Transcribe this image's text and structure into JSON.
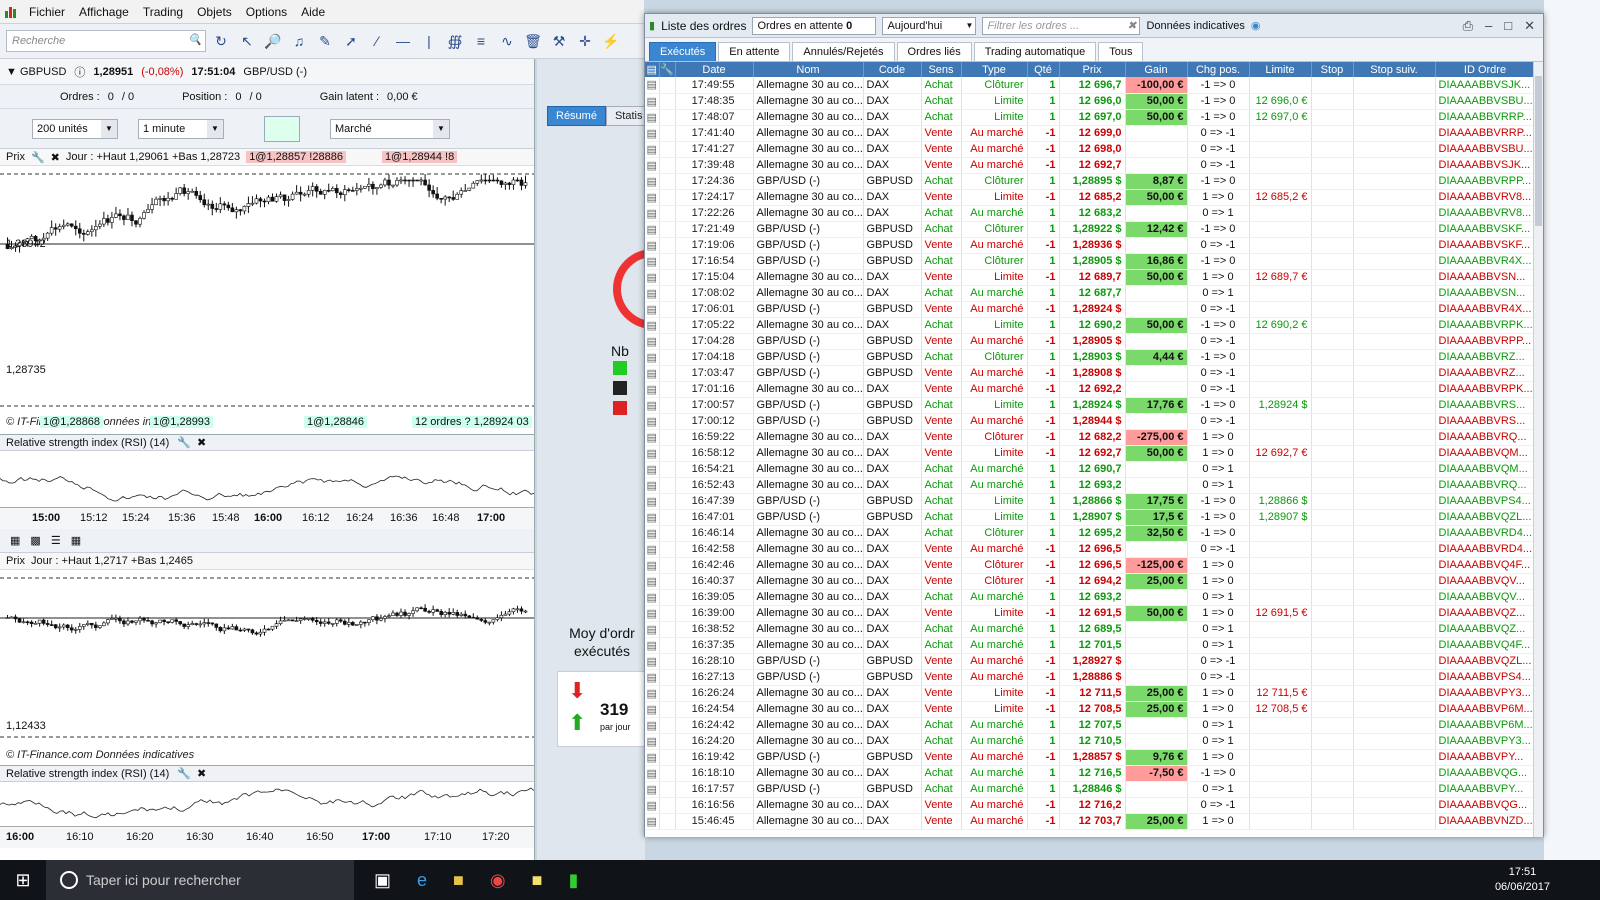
{
  "menu": {
    "items": [
      "Fichier",
      "Affichage",
      "Trading",
      "Objets",
      "Options",
      "Aide"
    ]
  },
  "toolbar": {
    "search_placeholder": "Recherche"
  },
  "symbol_bar": {
    "name": "GBPUSD",
    "price": "1,28951",
    "change": "(-0,08%)",
    "time": "17:51:04",
    "pair": "GBP/USD (-)"
  },
  "orders_bar": {
    "orders_label": "Ordres :",
    "orders_value": "0",
    "orders_slash": "/ 0",
    "position_label": "Position :",
    "position_value": "0",
    "position_slash": "/ 0",
    "gain_label": "Gain latent :",
    "gain_value": "0,00 €"
  },
  "controls": {
    "units": "200 unités",
    "timeframe": "1 minute",
    "order_type": "Marché"
  },
  "chart1": {
    "header": {
      "prefix": "Prix",
      "day": "Jour : +Haut 1,29061 +Bas 1,28723",
      "tag1": "1@1,28857 !28886",
      "tag2": "1@1,28944 !8"
    },
    "price_high": "1,28942",
    "price_low": "1,28735",
    "bottom_tags": [
      "1@1,28868",
      "1@1,28993",
      "1@1,28846",
      "12 ordres ? 1,28924 03"
    ],
    "footer": "© IT-Finance.com Données indicatives"
  },
  "rsi_label": "Relative strength index (RSI) (14)",
  "time_axis1": [
    "15:00",
    "15:12",
    "15:24",
    "15:36",
    "15:48",
    "16:00",
    "16:12",
    "16:24",
    "16:36",
    "16:48",
    "17:00"
  ],
  "chart2": {
    "header": {
      "prefix": "Prix",
      "day": "Jour : +Haut 1,2717 +Bas 1,2465"
    },
    "price_low": "1,12433",
    "footer": "© IT-Finance.com Données indicatives"
  },
  "time_axis2": [
    "16:00",
    "16:10",
    "16:20",
    "16:30",
    "16:40",
    "16:50",
    "17:00",
    "17:10",
    "17:20"
  ],
  "midpanel": {
    "tab1": "Résumé",
    "tab2": "Statis",
    "nb_label": "Nb",
    "avg_label": "Moy d'ordr exécutés",
    "count": "319",
    "per": "par jour"
  },
  "orders_window": {
    "title": "Liste des ordres",
    "pending_label": "Ordres en attente",
    "pending_count": "0",
    "date_select": "Aujourd'hui",
    "filter_placeholder": "Filtrer les ordres ...",
    "data_label": "Données indicatives",
    "tabs": [
      "Exécutés",
      "En attente",
      "Annulés/Rejetés",
      "Ordres liés",
      "Trading automatique",
      "Tous"
    ],
    "columns": [
      "Date",
      "Nom",
      "Code",
      "Sens",
      "Type",
      "Qté",
      "Prix",
      "Gain",
      "Chg pos.",
      "Limite",
      "Stop",
      "Stop suiv.",
      "ID Ordre"
    ],
    "rows": [
      {
        "date": "17:49:55",
        "nom": "Allemagne 30 au co...",
        "code": "DAX",
        "sens": "Achat",
        "type": "Clôturer",
        "qte": "1",
        "prix": "12 696,7",
        "gain": "-100,00 €",
        "chg": "-1 => 0",
        "limite": "",
        "id": "DIAAAABBVSJK..."
      },
      {
        "date": "17:48:35",
        "nom": "Allemagne 30 au co...",
        "code": "DAX",
        "sens": "Achat",
        "type": "Limite",
        "qte": "1",
        "prix": "12 696,0",
        "gain": "50,00 €",
        "chg": "-1 => 0",
        "limite": "12 696,0 €",
        "id": "DIAAAABBVSBU..."
      },
      {
        "date": "17:48:07",
        "nom": "Allemagne 30 au co...",
        "code": "DAX",
        "sens": "Achat",
        "type": "Limite",
        "qte": "1",
        "prix": "12 697,0",
        "gain": "50,00 €",
        "chg": "-1 => 0",
        "limite": "12 697,0 €",
        "id": "DIAAAABBVRRP..."
      },
      {
        "date": "17:41:40",
        "nom": "Allemagne 30 au co...",
        "code": "DAX",
        "sens": "Vente",
        "type": "Au marché",
        "qte": "-1",
        "prix": "12 699,0",
        "gain": "",
        "chg": "0 => -1",
        "limite": "",
        "id": "DIAAAABBVRRP..."
      },
      {
        "date": "17:41:27",
        "nom": "Allemagne 30 au co...",
        "code": "DAX",
        "sens": "Vente",
        "type": "Au marché",
        "qte": "-1",
        "prix": "12 698,0",
        "gain": "",
        "chg": "0 => -1",
        "limite": "",
        "id": "DIAAAABBVSBU..."
      },
      {
        "date": "17:39:48",
        "nom": "Allemagne 30 au co...",
        "code": "DAX",
        "sens": "Vente",
        "type": "Au marché",
        "qte": "-1",
        "prix": "12 692,7",
        "gain": "",
        "chg": "0 => -1",
        "limite": "",
        "id": "DIAAAABBVSJK..."
      },
      {
        "date": "17:24:36",
        "nom": "GBP/USD (-)",
        "code": "GBPUSD",
        "sens": "Achat",
        "type": "Clôturer",
        "qte": "1",
        "prix": "1,28895 $",
        "gain": "8,87 €",
        "chg": "-1 => 0",
        "limite": "",
        "id": "DIAAAABBVRPP..."
      },
      {
        "date": "17:24:17",
        "nom": "Allemagne 30 au co...",
        "code": "DAX",
        "sens": "Vente",
        "type": "Limite",
        "qte": "-1",
        "prix": "12 685,2",
        "gain": "50,00 €",
        "chg": "1 => 0",
        "limite": "12 685,2 €",
        "id": "DIAAAABBVRV8..."
      },
      {
        "date": "17:22:26",
        "nom": "Allemagne 30 au co...",
        "code": "DAX",
        "sens": "Achat",
        "type": "Au marché",
        "qte": "1",
        "prix": "12 683,2",
        "gain": "",
        "chg": "0 => 1",
        "limite": "",
        "id": "DIAAAABBVRV8..."
      },
      {
        "date": "17:21:49",
        "nom": "GBP/USD (-)",
        "code": "GBPUSD",
        "sens": "Achat",
        "type": "Clôturer",
        "qte": "1",
        "prix": "1,28922 $",
        "gain": "12,42 €",
        "chg": "-1 => 0",
        "limite": "",
        "id": "DIAAAABBVSKF..."
      },
      {
        "date": "17:19:06",
        "nom": "GBP/USD (-)",
        "code": "GBPUSD",
        "sens": "Vente",
        "type": "Au marché",
        "qte": "-1",
        "prix": "1,28936 $",
        "gain": "",
        "chg": "0 => -1",
        "limite": "",
        "id": "DIAAAABBVSKF..."
      },
      {
        "date": "17:16:54",
        "nom": "GBP/USD (-)",
        "code": "GBPUSD",
        "sens": "Achat",
        "type": "Clôturer",
        "qte": "1",
        "prix": "1,28905 $",
        "gain": "16,86 €",
        "chg": "-1 => 0",
        "limite": "",
        "id": "DIAAAABBVR4X..."
      },
      {
        "date": "17:15:04",
        "nom": "Allemagne 30 au co...",
        "code": "DAX",
        "sens": "Vente",
        "type": "Limite",
        "qte": "-1",
        "prix": "12 689,7",
        "gain": "50,00 €",
        "chg": "1 => 0",
        "limite": "12 689,7 €",
        "id": "DIAAAABBVSN..."
      },
      {
        "date": "17:08:02",
        "nom": "Allemagne 30 au co...",
        "code": "DAX",
        "sens": "Achat",
        "type": "Au marché",
        "qte": "1",
        "prix": "12 687,7",
        "gain": "",
        "chg": "0 => 1",
        "limite": "",
        "id": "DIAAAABBVSN..."
      },
      {
        "date": "17:06:01",
        "nom": "GBP/USD (-)",
        "code": "GBPUSD",
        "sens": "Vente",
        "type": "Au marché",
        "qte": "-1",
        "prix": "1,28924 $",
        "gain": "",
        "chg": "0 => -1",
        "limite": "",
        "id": "DIAAAABBVR4X..."
      },
      {
        "date": "17:05:22",
        "nom": "Allemagne 30 au co...",
        "code": "DAX",
        "sens": "Achat",
        "type": "Limite",
        "qte": "1",
        "prix": "12 690,2",
        "gain": "50,00 €",
        "chg": "-1 => 0",
        "limite": "12 690,2 €",
        "id": "DIAAAABBVRPK..."
      },
      {
        "date": "17:04:28",
        "nom": "GBP/USD (-)",
        "code": "GBPUSD",
        "sens": "Vente",
        "type": "Au marché",
        "qte": "-1",
        "prix": "1,28905 $",
        "gain": "",
        "chg": "0 => -1",
        "limite": "",
        "id": "DIAAAABBVRPP..."
      },
      {
        "date": "17:04:18",
        "nom": "GBP/USD (-)",
        "code": "GBPUSD",
        "sens": "Achat",
        "type": "Clôturer",
        "qte": "1",
        "prix": "1,28903 $",
        "gain": "4,44 €",
        "chg": "-1 => 0",
        "limite": "",
        "id": "DIAAAABBVRZ..."
      },
      {
        "date": "17:03:47",
        "nom": "GBP/USD (-)",
        "code": "GBPUSD",
        "sens": "Vente",
        "type": "Au marché",
        "qte": "-1",
        "prix": "1,28908 $",
        "gain": "",
        "chg": "0 => -1",
        "limite": "",
        "id": "DIAAAABBVRZ..."
      },
      {
        "date": "17:01:16",
        "nom": "Allemagne 30 au co...",
        "code": "DAX",
        "sens": "Vente",
        "type": "Au marché",
        "qte": "-1",
        "prix": "12 692,2",
        "gain": "",
        "chg": "0 => -1",
        "limite": "",
        "id": "DIAAAABBVRPK..."
      },
      {
        "date": "17:00:57",
        "nom": "GBP/USD (-)",
        "code": "GBPUSD",
        "sens": "Achat",
        "type": "Limite",
        "qte": "1",
        "prix": "1,28924 $",
        "gain": "17,76 €",
        "chg": "-1 => 0",
        "limite": "1,28924 $",
        "id": "DIAAAABBVRS..."
      },
      {
        "date": "17:00:12",
        "nom": "GBP/USD (-)",
        "code": "GBPUSD",
        "sens": "Vente",
        "type": "Au marché",
        "qte": "-1",
        "prix": "1,28944 $",
        "gain": "",
        "chg": "0 => -1",
        "limite": "",
        "id": "DIAAAABBVRS..."
      },
      {
        "date": "16:59:22",
        "nom": "Allemagne 30 au co...",
        "code": "DAX",
        "sens": "Vente",
        "type": "Clôturer",
        "qte": "-1",
        "prix": "12 682,2",
        "gain": "-275,00 €",
        "chg": "1 => 0",
        "limite": "",
        "id": "DIAAAABBVRQ..."
      },
      {
        "date": "16:58:12",
        "nom": "Allemagne 30 au co...",
        "code": "DAX",
        "sens": "Vente",
        "type": "Limite",
        "qte": "-1",
        "prix": "12 692,7",
        "gain": "50,00 €",
        "chg": "1 => 0",
        "limite": "12 692,7 €",
        "id": "DIAAAABBVQM..."
      },
      {
        "date": "16:54:21",
        "nom": "Allemagne 30 au co...",
        "code": "DAX",
        "sens": "Achat",
        "type": "Au marché",
        "qte": "1",
        "prix": "12 690,7",
        "gain": "",
        "chg": "0 => 1",
        "limite": "",
        "id": "DIAAAABBVQM..."
      },
      {
        "date": "16:52:43",
        "nom": "Allemagne 30 au co...",
        "code": "DAX",
        "sens": "Achat",
        "type": "Au marché",
        "qte": "1",
        "prix": "12 693,2",
        "gain": "",
        "chg": "0 => 1",
        "limite": "",
        "id": "DIAAAABBVRQ..."
      },
      {
        "date": "16:47:39",
        "nom": "GBP/USD (-)",
        "code": "GBPUSD",
        "sens": "Achat",
        "type": "Limite",
        "qte": "1",
        "prix": "1,28866 $",
        "gain": "17,75 €",
        "chg": "-1 => 0",
        "limite": "1,28866 $",
        "id": "DIAAAABBVPS4..."
      },
      {
        "date": "16:47:01",
        "nom": "GBP/USD (-)",
        "code": "GBPUSD",
        "sens": "Achat",
        "type": "Limite",
        "qte": "1",
        "prix": "1,28907 $",
        "gain": "17,5 €",
        "chg": "-1 => 0",
        "limite": "1,28907 $",
        "id": "DIAAAABBVQZL..."
      },
      {
        "date": "16:46:14",
        "nom": "Allemagne 30 au co...",
        "code": "DAX",
        "sens": "Achat",
        "type": "Clôturer",
        "qte": "1",
        "prix": "12 695,2",
        "gain": "32,50 €",
        "chg": "-1 => 0",
        "limite": "",
        "id": "DIAAAABBVRD4..."
      },
      {
        "date": "16:42:58",
        "nom": "Allemagne 30 au co...",
        "code": "DAX",
        "sens": "Vente",
        "type": "Au marché",
        "qte": "-1",
        "prix": "12 696,5",
        "gain": "",
        "chg": "0 => -1",
        "limite": "",
        "id": "DIAAAABBVRD4..."
      },
      {
        "date": "16:42:46",
        "nom": "Allemagne 30 au co...",
        "code": "DAX",
        "sens": "Vente",
        "type": "Clôturer",
        "qte": "-1",
        "prix": "12 696,5",
        "gain": "-125,00 €",
        "chg": "1 => 0",
        "limite": "",
        "id": "DIAAAABBVQ4F..."
      },
      {
        "date": "16:40:37",
        "nom": "Allemagne 30 au co...",
        "code": "DAX",
        "sens": "Vente",
        "type": "Clôturer",
        "qte": "-1",
        "prix": "12 694,2",
        "gain": "25,00 €",
        "chg": "1 => 0",
        "limite": "",
        "id": "DIAAAABBVQV..."
      },
      {
        "date": "16:39:05",
        "nom": "Allemagne 30 au co...",
        "code": "DAX",
        "sens": "Achat",
        "type": "Au marché",
        "qte": "1",
        "prix": "12 693,2",
        "gain": "",
        "chg": "0 => 1",
        "limite": "",
        "id": "DIAAAABBVQV..."
      },
      {
        "date": "16:39:00",
        "nom": "Allemagne 30 au co...",
        "code": "DAX",
        "sens": "Vente",
        "type": "Limite",
        "qte": "-1",
        "prix": "12 691,5",
        "gain": "50,00 €",
        "chg": "1 => 0",
        "limite": "12 691,5 €",
        "id": "DIAAAABBVQZ..."
      },
      {
        "date": "16:38:52",
        "nom": "Allemagne 30 au co...",
        "code": "DAX",
        "sens": "Achat",
        "type": "Au marché",
        "qte": "1",
        "prix": "12 689,5",
        "gain": "",
        "chg": "0 => 1",
        "limite": "",
        "id": "DIAAAABBVQZ..."
      },
      {
        "date": "16:37:35",
        "nom": "Allemagne 30 au co...",
        "code": "DAX",
        "sens": "Achat",
        "type": "Au marché",
        "qte": "1",
        "prix": "12 701,5",
        "gain": "",
        "chg": "0 => 1",
        "limite": "",
        "id": "DIAAAABBVQ4F..."
      },
      {
        "date": "16:28:10",
        "nom": "GBP/USD (-)",
        "code": "GBPUSD",
        "sens": "Vente",
        "type": "Au marché",
        "qte": "-1",
        "prix": "1,28927 $",
        "gain": "",
        "chg": "0 => -1",
        "limite": "",
        "id": "DIAAAABBVQZL..."
      },
      {
        "date": "16:27:13",
        "nom": "GBP/USD (-)",
        "code": "GBPUSD",
        "sens": "Vente",
        "type": "Au marché",
        "qte": "-1",
        "prix": "1,28886 $",
        "gain": "",
        "chg": "0 => -1",
        "limite": "",
        "id": "DIAAAABBVPS4..."
      },
      {
        "date": "16:26:24",
        "nom": "Allemagne 30 au co...",
        "code": "DAX",
        "sens": "Vente",
        "type": "Limite",
        "qte": "-1",
        "prix": "12 711,5",
        "gain": "25,00 €",
        "chg": "1 => 0",
        "limite": "12 711,5 €",
        "id": "DIAAAABBVPY3..."
      },
      {
        "date": "16:24:54",
        "nom": "Allemagne 30 au co...",
        "code": "DAX",
        "sens": "Vente",
        "type": "Limite",
        "qte": "-1",
        "prix": "12 708,5",
        "gain": "25,00 €",
        "chg": "1 => 0",
        "limite": "12 708,5 €",
        "id": "DIAAAABBVP6M..."
      },
      {
        "date": "16:24:42",
        "nom": "Allemagne 30 au co...",
        "code": "DAX",
        "sens": "Achat",
        "type": "Au marché",
        "qte": "1",
        "prix": "12 707,5",
        "gain": "",
        "chg": "0 => 1",
        "limite": "",
        "id": "DIAAAABBVP6M..."
      },
      {
        "date": "16:24:20",
        "nom": "Allemagne 30 au co...",
        "code": "DAX",
        "sens": "Achat",
        "type": "Au marché",
        "qte": "1",
        "prix": "12 710,5",
        "gain": "",
        "chg": "0 => 1",
        "limite": "",
        "id": "DIAAAABBVPY3..."
      },
      {
        "date": "16:19:42",
        "nom": "GBP/USD (-)",
        "code": "GBPUSD",
        "sens": "Vente",
        "type": "Au marché",
        "qte": "-1",
        "prix": "1,28857 $",
        "gain": "9,76 €",
        "chg": "1 => 0",
        "limite": "",
        "id": "DIAAAABBVPY..."
      },
      {
        "date": "16:18:10",
        "nom": "Allemagne 30 au co...",
        "code": "DAX",
        "sens": "Achat",
        "type": "Au marché",
        "qte": "1",
        "prix": "12 716,5",
        "gain": "-7,50 €",
        "chg": "-1 => 0",
        "limite": "",
        "id": "DIAAAABBVQG..."
      },
      {
        "date": "16:17:57",
        "nom": "GBP/USD (-)",
        "code": "GBPUSD",
        "sens": "Achat",
        "type": "Au marché",
        "qte": "1",
        "prix": "1,28846 $",
        "gain": "",
        "chg": "0 => 1",
        "limite": "",
        "id": "DIAAAABBVPY..."
      },
      {
        "date": "16:16:56",
        "nom": "Allemagne 30 au co...",
        "code": "DAX",
        "sens": "Vente",
        "type": "Au marché",
        "qte": "-1",
        "prix": "12 716,2",
        "gain": "",
        "chg": "0 => -1",
        "limite": "",
        "id": "DIAAAABBVQG..."
      },
      {
        "date": "15:46:45",
        "nom": "Allemagne 30 au co...",
        "code": "DAX",
        "sens": "Vente",
        "type": "Au marché",
        "qte": "-1",
        "prix": "12 703,7",
        "gain": "25,00 €",
        "chg": "1 => 0",
        "limite": "",
        "id": "DIAAAABBVNZD..."
      }
    ]
  },
  "taskbar": {
    "search": "Taper ici pour rechercher",
    "time": "17:51",
    "date": "06/06/2017"
  }
}
